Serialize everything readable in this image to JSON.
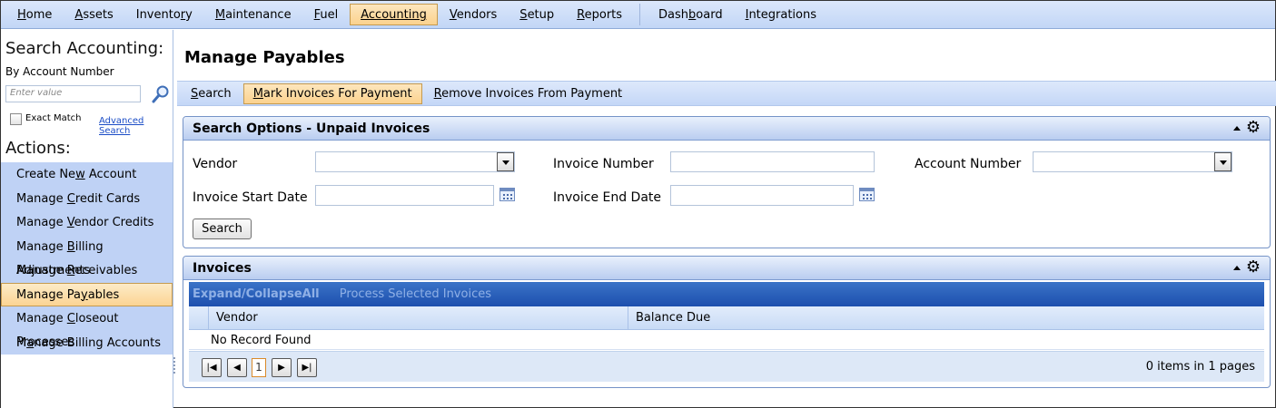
{
  "topnav": {
    "items": [
      {
        "label": "Home",
        "u": "H",
        "rest": "ome",
        "pre": ""
      },
      {
        "label": "Assets",
        "u": "A",
        "rest": "ssets",
        "pre": ""
      },
      {
        "label": "Inventory",
        "pre": "Invento",
        "u": "r",
        "rest": "y"
      },
      {
        "label": "Maintenance",
        "u": "M",
        "rest": "aintenance",
        "pre": ""
      },
      {
        "label": "Fuel",
        "u": "F",
        "rest": "uel",
        "pre": ""
      },
      {
        "label": "Accounting",
        "u": "A",
        "rest": "ccounting",
        "pre": "",
        "active": true
      },
      {
        "label": "Vendors",
        "u": "V",
        "rest": "endors",
        "pre": ""
      },
      {
        "label": "Setup",
        "u": "S",
        "rest": "etup",
        "pre": ""
      },
      {
        "label": "Reports",
        "u": "R",
        "rest": "eports",
        "pre": ""
      }
    ],
    "items_right": [
      {
        "label": "Dashboard",
        "pre": "Dash",
        "u": "b",
        "rest": "oard"
      },
      {
        "label": "Integrations",
        "u": "I",
        "rest": "ntegrations",
        "pre": ""
      }
    ]
  },
  "sidebar": {
    "search_title": "Search Accounting:",
    "search_sub": "By Account Number",
    "search_placeholder": "Enter value",
    "exact_match_label": "Exact Match",
    "advanced_search_label": "Advanced Search",
    "actions_title": "Actions:",
    "actions": [
      {
        "pre": "Create Ne",
        "u": "w",
        "rest": " Account"
      },
      {
        "pre": "Manage ",
        "u": "C",
        "rest": "redit Cards"
      },
      {
        "pre": "Manage ",
        "u": "V",
        "rest": "endor Credits"
      },
      {
        "pre": "Manage ",
        "u": "B",
        "rest": "illing Adjustments"
      },
      {
        "pre": "Manage ",
        "u": "R",
        "rest": "eceivables"
      },
      {
        "pre": "Manage Pa",
        "u": "y",
        "rest": "ables",
        "active": true
      },
      {
        "pre": "Manage ",
        "u": "C",
        "rest": "loseout Processes"
      },
      {
        "pre": "M",
        "u": "a",
        "rest": "nage Billing Accounts"
      }
    ]
  },
  "main": {
    "page_title": "Manage Payables",
    "toolbar": [
      {
        "pre": "",
        "u": "S",
        "rest": "earch"
      },
      {
        "pre": "",
        "u": "M",
        "rest": "ark Invoices For Payment",
        "active": true
      },
      {
        "pre": "",
        "u": "R",
        "rest": "emove Invoices From Payment"
      }
    ],
    "search_panel": {
      "title": "Search Options - Unpaid Invoices",
      "vendor_label": "Vendor",
      "invoice_number_label": "Invoice Number",
      "account_number_label": "Account Number",
      "start_date_label": "Invoice Start Date",
      "end_date_label": "Invoice End Date",
      "search_button": "Search"
    },
    "invoices_panel": {
      "title": "Invoices",
      "expand_collapse": "Expand/CollapseAll",
      "process_selected": "Process Selected Invoices",
      "columns": [
        "Vendor",
        "Balance Due"
      ],
      "empty_text": "No Record Found",
      "current_page": "1",
      "pager_info": "0 items in 1 pages"
    }
  }
}
